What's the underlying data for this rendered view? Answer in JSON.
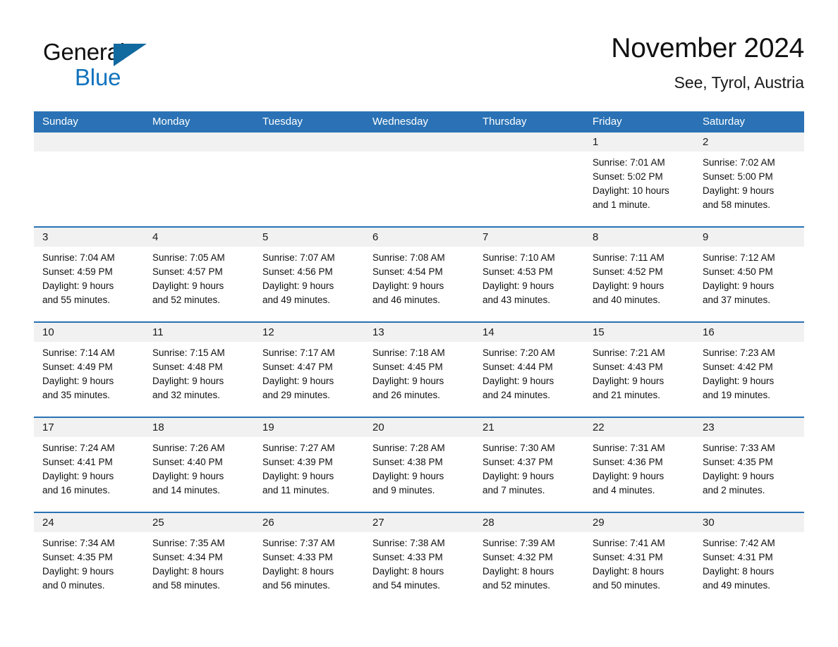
{
  "brand": {
    "name_part1": "General",
    "name_part2": "Blue",
    "flag_icon": "triangle-flag-icon",
    "accent_color": "#1273bd"
  },
  "header": {
    "title": "November 2024",
    "location": "See, Tyrol, Austria"
  },
  "colors": {
    "header_blue": "#2a72b5",
    "date_band": "#f1f1f1",
    "text": "#101010"
  },
  "calendar": {
    "weekday_headers": [
      "Sunday",
      "Monday",
      "Tuesday",
      "Wednesday",
      "Thursday",
      "Friday",
      "Saturday"
    ],
    "weeks": [
      [
        {
          "date": "",
          "empty": true
        },
        {
          "date": "",
          "empty": true
        },
        {
          "date": "",
          "empty": true
        },
        {
          "date": "",
          "empty": true
        },
        {
          "date": "",
          "empty": true
        },
        {
          "date": "1",
          "sunrise": "Sunrise: 7:01 AM",
          "sunset": "Sunset: 5:02 PM",
          "daylight1": "Daylight: 10 hours",
          "daylight2": "and 1 minute."
        },
        {
          "date": "2",
          "sunrise": "Sunrise: 7:02 AM",
          "sunset": "Sunset: 5:00 PM",
          "daylight1": "Daylight: 9 hours",
          "daylight2": "and 58 minutes."
        }
      ],
      [
        {
          "date": "3",
          "sunrise": "Sunrise: 7:04 AM",
          "sunset": "Sunset: 4:59 PM",
          "daylight1": "Daylight: 9 hours",
          "daylight2": "and 55 minutes."
        },
        {
          "date": "4",
          "sunrise": "Sunrise: 7:05 AM",
          "sunset": "Sunset: 4:57 PM",
          "daylight1": "Daylight: 9 hours",
          "daylight2": "and 52 minutes."
        },
        {
          "date": "5",
          "sunrise": "Sunrise: 7:07 AM",
          "sunset": "Sunset: 4:56 PM",
          "daylight1": "Daylight: 9 hours",
          "daylight2": "and 49 minutes."
        },
        {
          "date": "6",
          "sunrise": "Sunrise: 7:08 AM",
          "sunset": "Sunset: 4:54 PM",
          "daylight1": "Daylight: 9 hours",
          "daylight2": "and 46 minutes."
        },
        {
          "date": "7",
          "sunrise": "Sunrise: 7:10 AM",
          "sunset": "Sunset: 4:53 PM",
          "daylight1": "Daylight: 9 hours",
          "daylight2": "and 43 minutes."
        },
        {
          "date": "8",
          "sunrise": "Sunrise: 7:11 AM",
          "sunset": "Sunset: 4:52 PM",
          "daylight1": "Daylight: 9 hours",
          "daylight2": "and 40 minutes."
        },
        {
          "date": "9",
          "sunrise": "Sunrise: 7:12 AM",
          "sunset": "Sunset: 4:50 PM",
          "daylight1": "Daylight: 9 hours",
          "daylight2": "and 37 minutes."
        }
      ],
      [
        {
          "date": "10",
          "sunrise": "Sunrise: 7:14 AM",
          "sunset": "Sunset: 4:49 PM",
          "daylight1": "Daylight: 9 hours",
          "daylight2": "and 35 minutes."
        },
        {
          "date": "11",
          "sunrise": "Sunrise: 7:15 AM",
          "sunset": "Sunset: 4:48 PM",
          "daylight1": "Daylight: 9 hours",
          "daylight2": "and 32 minutes."
        },
        {
          "date": "12",
          "sunrise": "Sunrise: 7:17 AM",
          "sunset": "Sunset: 4:47 PM",
          "daylight1": "Daylight: 9 hours",
          "daylight2": "and 29 minutes."
        },
        {
          "date": "13",
          "sunrise": "Sunrise: 7:18 AM",
          "sunset": "Sunset: 4:45 PM",
          "daylight1": "Daylight: 9 hours",
          "daylight2": "and 26 minutes."
        },
        {
          "date": "14",
          "sunrise": "Sunrise: 7:20 AM",
          "sunset": "Sunset: 4:44 PM",
          "daylight1": "Daylight: 9 hours",
          "daylight2": "and 24 minutes."
        },
        {
          "date": "15",
          "sunrise": "Sunrise: 7:21 AM",
          "sunset": "Sunset: 4:43 PM",
          "daylight1": "Daylight: 9 hours",
          "daylight2": "and 21 minutes."
        },
        {
          "date": "16",
          "sunrise": "Sunrise: 7:23 AM",
          "sunset": "Sunset: 4:42 PM",
          "daylight1": "Daylight: 9 hours",
          "daylight2": "and 19 minutes."
        }
      ],
      [
        {
          "date": "17",
          "sunrise": "Sunrise: 7:24 AM",
          "sunset": "Sunset: 4:41 PM",
          "daylight1": "Daylight: 9 hours",
          "daylight2": "and 16 minutes."
        },
        {
          "date": "18",
          "sunrise": "Sunrise: 7:26 AM",
          "sunset": "Sunset: 4:40 PM",
          "daylight1": "Daylight: 9 hours",
          "daylight2": "and 14 minutes."
        },
        {
          "date": "19",
          "sunrise": "Sunrise: 7:27 AM",
          "sunset": "Sunset: 4:39 PM",
          "daylight1": "Daylight: 9 hours",
          "daylight2": "and 11 minutes."
        },
        {
          "date": "20",
          "sunrise": "Sunrise: 7:28 AM",
          "sunset": "Sunset: 4:38 PM",
          "daylight1": "Daylight: 9 hours",
          "daylight2": "and 9 minutes."
        },
        {
          "date": "21",
          "sunrise": "Sunrise: 7:30 AM",
          "sunset": "Sunset: 4:37 PM",
          "daylight1": "Daylight: 9 hours",
          "daylight2": "and 7 minutes."
        },
        {
          "date": "22",
          "sunrise": "Sunrise: 7:31 AM",
          "sunset": "Sunset: 4:36 PM",
          "daylight1": "Daylight: 9 hours",
          "daylight2": "and 4 minutes."
        },
        {
          "date": "23",
          "sunrise": "Sunrise: 7:33 AM",
          "sunset": "Sunset: 4:35 PM",
          "daylight1": "Daylight: 9 hours",
          "daylight2": "and 2 minutes."
        }
      ],
      [
        {
          "date": "24",
          "sunrise": "Sunrise: 7:34 AM",
          "sunset": "Sunset: 4:35 PM",
          "daylight1": "Daylight: 9 hours",
          "daylight2": "and 0 minutes."
        },
        {
          "date": "25",
          "sunrise": "Sunrise: 7:35 AM",
          "sunset": "Sunset: 4:34 PM",
          "daylight1": "Daylight: 8 hours",
          "daylight2": "and 58 minutes."
        },
        {
          "date": "26",
          "sunrise": "Sunrise: 7:37 AM",
          "sunset": "Sunset: 4:33 PM",
          "daylight1": "Daylight: 8 hours",
          "daylight2": "and 56 minutes."
        },
        {
          "date": "27",
          "sunrise": "Sunrise: 7:38 AM",
          "sunset": "Sunset: 4:33 PM",
          "daylight1": "Daylight: 8 hours",
          "daylight2": "and 54 minutes."
        },
        {
          "date": "28",
          "sunrise": "Sunrise: 7:39 AM",
          "sunset": "Sunset: 4:32 PM",
          "daylight1": "Daylight: 8 hours",
          "daylight2": "and 52 minutes."
        },
        {
          "date": "29",
          "sunrise": "Sunrise: 7:41 AM",
          "sunset": "Sunset: 4:31 PM",
          "daylight1": "Daylight: 8 hours",
          "daylight2": "and 50 minutes."
        },
        {
          "date": "30",
          "sunrise": "Sunrise: 7:42 AM",
          "sunset": "Sunset: 4:31 PM",
          "daylight1": "Daylight: 8 hours",
          "daylight2": "and 49 minutes."
        }
      ]
    ]
  }
}
